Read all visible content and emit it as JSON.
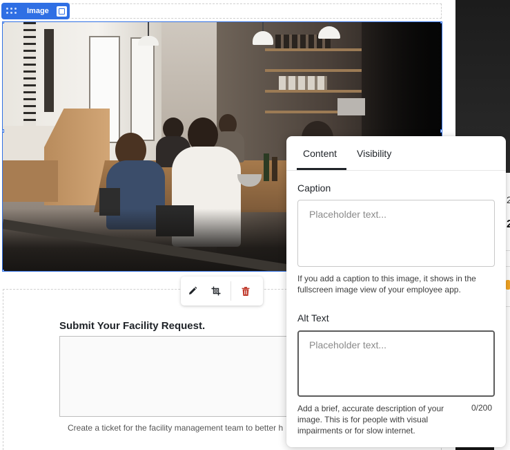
{
  "block_badge": {
    "label": "Image",
    "drag_icon": "grip-icon",
    "toggle_icon": "square-icon"
  },
  "image_toolbar": {
    "edit_icon": "pencil-icon",
    "crop_icon": "crop-icon",
    "delete_icon": "trash-icon",
    "delete_color": "#c0392b"
  },
  "form": {
    "title": "Submit Your Facility Request.",
    "help_text": "Create a ticket for the facility management team to better h"
  },
  "panel": {
    "tabs": [
      {
        "label": "Content",
        "active": true
      },
      {
        "label": "Visibility",
        "active": false
      }
    ],
    "caption": {
      "label": "Caption",
      "placeholder": "Placeholder text...",
      "value": "",
      "help": "If you add a caption to this image, it shows in the fullscreen image view of your employee app."
    },
    "alt_text": {
      "label": "Alt Text",
      "placeholder": "Placeholder text...",
      "value": "",
      "help": "Add a brief, accurate description of your image. This is for people with visual impairments or for slow internet.",
      "counter": "0/200"
    }
  },
  "background_peek": {
    "text_a": "2",
    "text_b": "2"
  },
  "colors": {
    "accent": "#2f6fe4",
    "text": "#1f2328",
    "danger": "#c0392b"
  }
}
